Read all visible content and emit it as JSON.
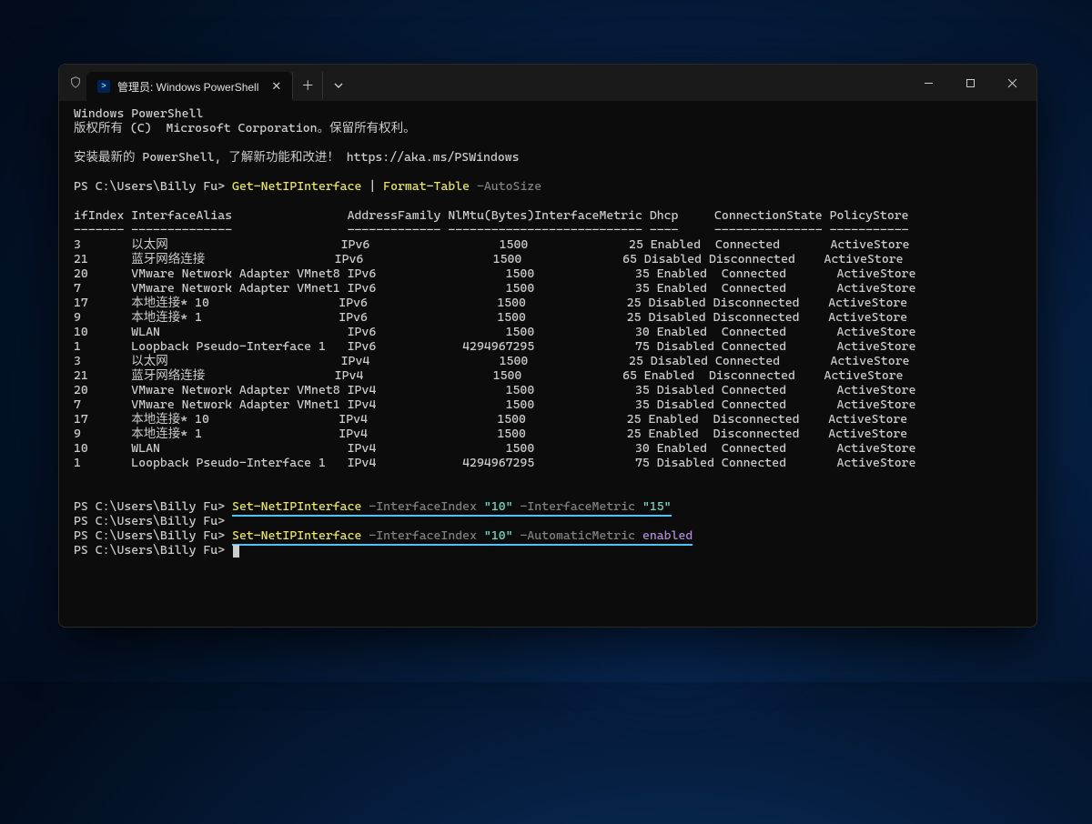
{
  "tab": {
    "title": "管理员: Windows PowerShell"
  },
  "header": {
    "l1": "Windows PowerShell",
    "l2": "版权所有 (C)  Microsoft Corporation。保留所有权利。",
    "l3a": "安装最新的 PowerShell, 了解新功能和改进！",
    "l3b": "https://aka.ms/PSWindows"
  },
  "prompt": "PS C:\\Users\\Billy Fu>",
  "cmd1": {
    "cmd": "Get-NetIPInterface",
    "pipe": " | ",
    "cmd2": "Format-Table",
    "param": " -AutoSize"
  },
  "cols": {
    "c1": "ifIndex",
    "c2": "InterfaceAlias",
    "c3": "AddressFamily",
    "c4": "NlMtu(Bytes)",
    "c5": "InterfaceMetric",
    "c6": "Dhcp",
    "c7": "ConnectionState",
    "c8": "PolicyStore"
  },
  "dash": {
    "c1": "-------",
    "c2": "--------------",
    "c3": "-------------",
    "c4": "------------",
    "c5": "---------------",
    "c6": "----",
    "c7": "---------------",
    "c8": "-----------"
  },
  "rows": [
    {
      "i": "3",
      "a": "以太网",
      "f": "IPv6",
      "m": "1500",
      "mt": "25",
      "d": "Enabled",
      "c": "Connected",
      "p": "ActiveStore"
    },
    {
      "i": "21",
      "a": "蓝牙网络连接",
      "f": "IPv6",
      "m": "1500",
      "mt": "65",
      "d": "Disabled",
      "c": "Disconnected",
      "p": "ActiveStore"
    },
    {
      "i": "20",
      "a": "VMware Network Adapter VMnet8",
      "f": "IPv6",
      "m": "1500",
      "mt": "35",
      "d": "Enabled",
      "c": "Connected",
      "p": "ActiveStore"
    },
    {
      "i": "7",
      "a": "VMware Network Adapter VMnet1",
      "f": "IPv6",
      "m": "1500",
      "mt": "35",
      "d": "Enabled",
      "c": "Connected",
      "p": "ActiveStore"
    },
    {
      "i": "17",
      "a": "本地连接* 10",
      "f": "IPv6",
      "m": "1500",
      "mt": "25",
      "d": "Disabled",
      "c": "Disconnected",
      "p": "ActiveStore"
    },
    {
      "i": "9",
      "a": "本地连接* 1",
      "f": "IPv6",
      "m": "1500",
      "mt": "25",
      "d": "Disabled",
      "c": "Disconnected",
      "p": "ActiveStore"
    },
    {
      "i": "10",
      "a": "WLAN",
      "f": "IPv6",
      "m": "1500",
      "mt": "30",
      "d": "Enabled",
      "c": "Connected",
      "p": "ActiveStore"
    },
    {
      "i": "1",
      "a": "Loopback Pseudo-Interface 1",
      "f": "IPv6",
      "m": "4294967295",
      "mt": "75",
      "d": "Disabled",
      "c": "Connected",
      "p": "ActiveStore"
    },
    {
      "i": "3",
      "a": "以太网",
      "f": "IPv4",
      "m": "1500",
      "mt": "25",
      "d": "Disabled",
      "c": "Connected",
      "p": "ActiveStore"
    },
    {
      "i": "21",
      "a": "蓝牙网络连接",
      "f": "IPv4",
      "m": "1500",
      "mt": "65",
      "d": "Enabled",
      "c": "Disconnected",
      "p": "ActiveStore"
    },
    {
      "i": "20",
      "a": "VMware Network Adapter VMnet8",
      "f": "IPv4",
      "m": "1500",
      "mt": "35",
      "d": "Disabled",
      "c": "Connected",
      "p": "ActiveStore"
    },
    {
      "i": "7",
      "a": "VMware Network Adapter VMnet1",
      "f": "IPv4",
      "m": "1500",
      "mt": "35",
      "d": "Disabled",
      "c": "Connected",
      "p": "ActiveStore"
    },
    {
      "i": "17",
      "a": "本地连接* 10",
      "f": "IPv4",
      "m": "1500",
      "mt": "25",
      "d": "Enabled",
      "c": "Disconnected",
      "p": "ActiveStore"
    },
    {
      "i": "9",
      "a": "本地连接* 1",
      "f": "IPv4",
      "m": "1500",
      "mt": "25",
      "d": "Enabled",
      "c": "Disconnected",
      "p": "ActiveStore"
    },
    {
      "i": "10",
      "a": "WLAN",
      "f": "IPv4",
      "m": "1500",
      "mt": "30",
      "d": "Enabled",
      "c": "Connected",
      "p": "ActiveStore"
    },
    {
      "i": "1",
      "a": "Loopback Pseudo-Interface 1",
      "f": "IPv4",
      "m": "4294967295",
      "mt": "75",
      "d": "Disabled",
      "c": "Connected",
      "p": "ActiveStore"
    }
  ],
  "cmd2": {
    "cmd": "Set-NetIPInterface",
    "p1": " -InterfaceIndex ",
    "v1": "\"10\"",
    "p2": " -InterfaceMetric ",
    "v2": "\"15\""
  },
  "cmd3": {
    "cmd": "Set-NetIPInterface",
    "p1": " -InterfaceIndex ",
    "v1": "\"10\"",
    "p2": " -AutomaticMetric ",
    "v2": "enabled"
  }
}
